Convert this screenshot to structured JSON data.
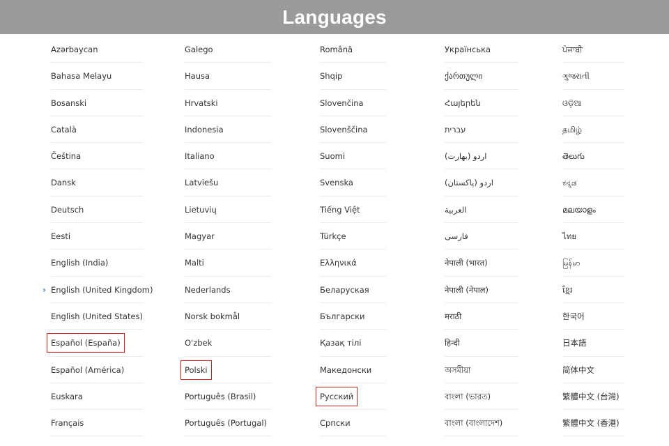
{
  "header": {
    "title": "Languages"
  },
  "columns": [
    {
      "items": [
        {
          "label": "Azərbaycan"
        },
        {
          "label": "Bahasa Melayu"
        },
        {
          "label": "Bosanski"
        },
        {
          "label": "Català"
        },
        {
          "label": "Čeština"
        },
        {
          "label": "Dansk"
        },
        {
          "label": "Deutsch"
        },
        {
          "label": "Eesti"
        },
        {
          "label": "English (India)"
        },
        {
          "label": "English (United Kingdom)",
          "selected": true
        },
        {
          "label": "English (United States)"
        },
        {
          "label": "Español (España)",
          "highlighted": true
        },
        {
          "label": "Español (América)"
        },
        {
          "label": "Euskara"
        },
        {
          "label": "Français"
        }
      ]
    },
    {
      "items": [
        {
          "label": "Galego"
        },
        {
          "label": "Hausa"
        },
        {
          "label": "Hrvatski"
        },
        {
          "label": "Indonesia"
        },
        {
          "label": "Italiano"
        },
        {
          "label": "Latviešu"
        },
        {
          "label": "Lietuvių"
        },
        {
          "label": "Magyar"
        },
        {
          "label": "Malti"
        },
        {
          "label": "Nederlands"
        },
        {
          "label": "Norsk bokmål"
        },
        {
          "label": "O'zbek"
        },
        {
          "label": "Polski",
          "highlighted": true
        },
        {
          "label": "Português (Brasil)"
        },
        {
          "label": "Português (Portugal)"
        }
      ]
    },
    {
      "items": [
        {
          "label": "Română"
        },
        {
          "label": "Shqip"
        },
        {
          "label": "Slovenčina"
        },
        {
          "label": "Slovenščina"
        },
        {
          "label": "Suomi"
        },
        {
          "label": "Svenska"
        },
        {
          "label": "Tiếng Việt"
        },
        {
          "label": "Türkçe"
        },
        {
          "label": "Ελληνικά"
        },
        {
          "label": "Беларуская"
        },
        {
          "label": "Български"
        },
        {
          "label": "Қазақ тілі"
        },
        {
          "label": "Македонски"
        },
        {
          "label": "Русский",
          "highlighted": true
        },
        {
          "label": "Српски"
        }
      ]
    },
    {
      "items": [
        {
          "label": "Українська"
        },
        {
          "label": "ქართული"
        },
        {
          "label": "Հայերեն"
        },
        {
          "label": "עברית"
        },
        {
          "label": "اردو (بھارت)"
        },
        {
          "label": "اردو (پاکستان)"
        },
        {
          "label": "العربية"
        },
        {
          "label": "فارسی"
        },
        {
          "label": "नेपाली (भारत)"
        },
        {
          "label": "नेपाली (नेपाल)"
        },
        {
          "label": "मराठी"
        },
        {
          "label": "हिन्दी"
        },
        {
          "label": "অসমীয়া"
        },
        {
          "label": "বাংলা (ভারত)"
        },
        {
          "label": "বাংলা (বাংলাদেশ)"
        }
      ]
    },
    {
      "items": [
        {
          "label": "ਪੰਜਾਬੀ"
        },
        {
          "label": "ગુજરાતી"
        },
        {
          "label": "ଓଡ଼ିଆ"
        },
        {
          "label": "தமிழ்"
        },
        {
          "label": "తెలుగు"
        },
        {
          "label": "ಕನ್ನಡ"
        },
        {
          "label": "മലയാളം"
        },
        {
          "label": "ไทย"
        },
        {
          "label": "မြန်မာ"
        },
        {
          "label": "ខ្មែរ"
        },
        {
          "label": "한국어"
        },
        {
          "label": "日本語"
        },
        {
          "label": "简体中文"
        },
        {
          "label": "繁體中文 (台灣)"
        },
        {
          "label": "繁體中文 (香港)"
        }
      ]
    }
  ],
  "colors": {
    "header_bg": "#9a9a9a",
    "header_text": "#ffffff",
    "highlight_border": "#d9211e",
    "selected_chevron": "#3f7fd0",
    "divider": "#ececec"
  },
  "icons": {
    "selected_marker": "chevron-right-icon"
  }
}
